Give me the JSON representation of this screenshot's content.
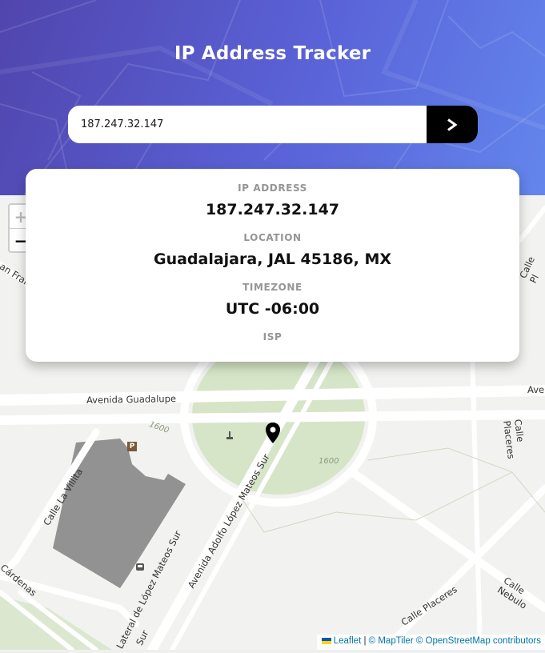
{
  "app": {
    "title": "IP Address Tracker"
  },
  "search": {
    "value": "187.247.32.147",
    "button_icon": "chevron-right-icon"
  },
  "info": {
    "ip_label": "IP ADDRESS",
    "ip_value": "187.247.32.147",
    "location_label": "LOCATION",
    "location_value": "Guadalajara, JAL 45186, MX",
    "timezone_label": "TIMEZONE",
    "timezone_value": "UTC -06:00",
    "isp_label": "ISP",
    "isp_value": ""
  },
  "map": {
    "zoom_in": "+",
    "zoom_out": "−",
    "streets": {
      "avenida_guadalupe": "Avenida Guadalupe",
      "avenida_right": "Ave",
      "calle_placeres_right": "Calle Placeres",
      "calle_placeres_bottom": "Calle Placeres",
      "calle_la_villita": "Calle La Villita",
      "lateral": "Lateral de López Mateos Sur",
      "adolfo": "Avenida Adolfo López Mateos Sur",
      "mateos_sur": "Mateos Sur",
      "calle_nebulo": "Calle Nebulo",
      "cardenas": "Cárdenas",
      "calle_pl_top": "Calle Pl",
      "franc": "an Franc",
      "sur_bottom": "Sur",
      "elev_1": "1600",
      "elev_2": "1600"
    },
    "parking_label": "P"
  },
  "attribution": {
    "leaflet": "Leaflet",
    "sep": "|",
    "maptiler": "© MapTiler",
    "osm": "© OpenStreetMap contributors"
  }
}
